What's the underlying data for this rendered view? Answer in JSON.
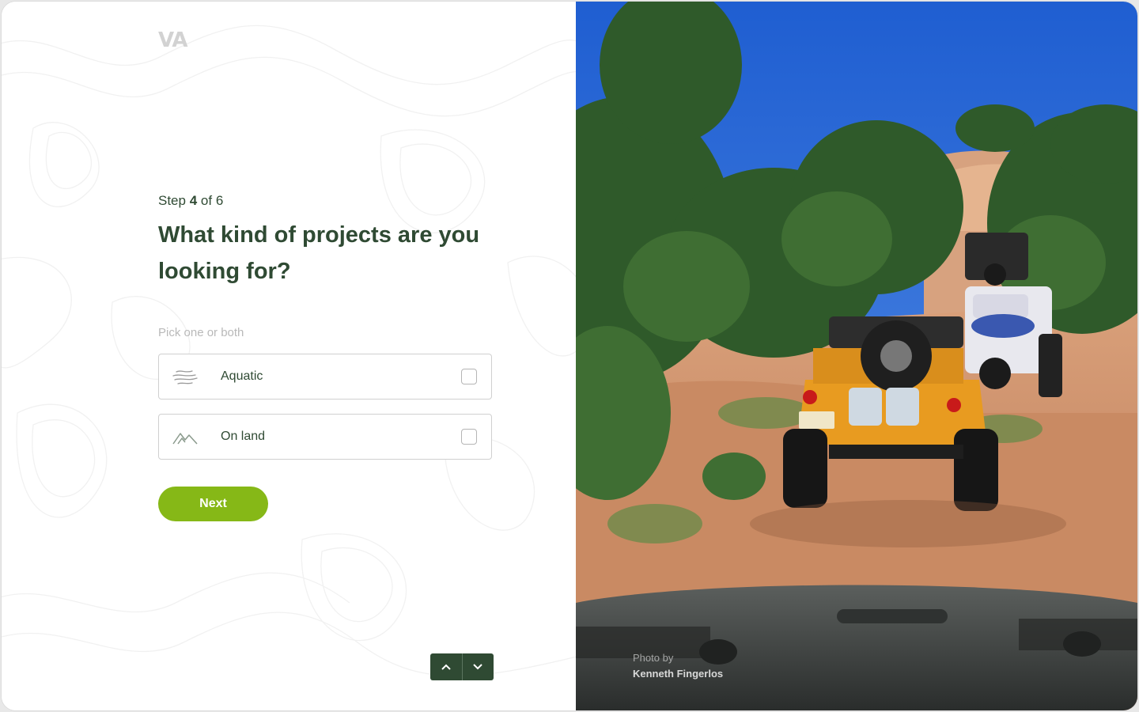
{
  "brand": {
    "logo_text": "VA"
  },
  "form": {
    "step_prefix": "Step",
    "step_current": "4",
    "step_suffix": "of 6",
    "question": "What kind of projects are you looking for?",
    "hint": "Pick one or both",
    "options": [
      {
        "label": "Aquatic",
        "icon": "waves-icon",
        "checked": false
      },
      {
        "label": "On land",
        "icon": "mountains-icon",
        "checked": false
      }
    ],
    "next_label": "Next"
  },
  "nav": {
    "up_icon": "chevron-up-icon",
    "down_icon": "chevron-down-icon"
  },
  "photo": {
    "credit_prefix": "Photo by",
    "credit_name": "Kenneth Fingerlos"
  },
  "colors": {
    "primary_text": "#2f4a33",
    "accent": "#86b817",
    "nav_bg": "#2f4a33",
    "hint_text": "#b9b9b9"
  }
}
